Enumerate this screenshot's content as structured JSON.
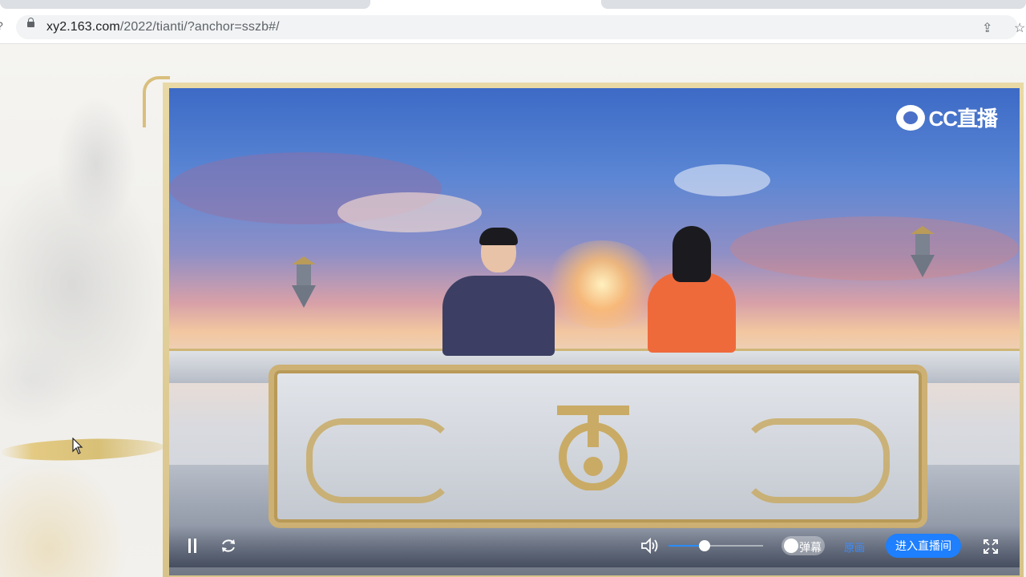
{
  "browser": {
    "url_host": "xy2.163.com",
    "url_path": "/2022/tianti/?anchor=sszb#/"
  },
  "player": {
    "logo_text": "CC直播",
    "controls": {
      "danmu_label": "弹幕",
      "quality_label": "原画",
      "enter_room_label": "进入直播间",
      "volume_level": 0.38,
      "danmu_enabled": false
    }
  },
  "colors": {
    "accent_blue": "#1e7fff",
    "frame_gold": "#d8c38a"
  }
}
